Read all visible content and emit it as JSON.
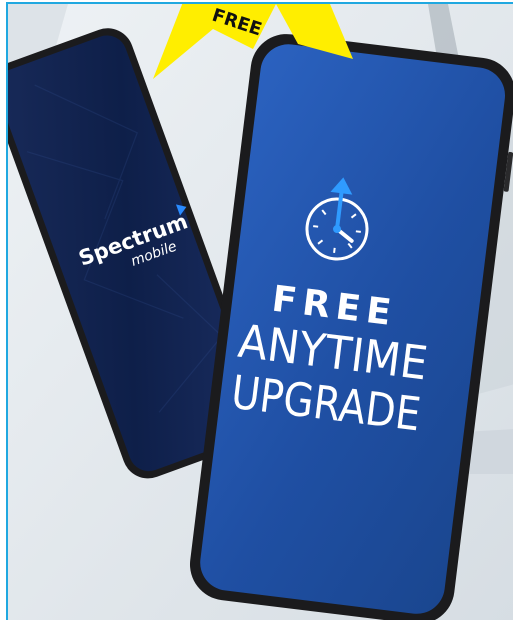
{
  "burst": {
    "label": "FREE"
  },
  "left_phone": {
    "brand": "Spectrum",
    "sub_brand": "mobile"
  },
  "right_phone": {
    "line1": "FREE",
    "line2": "ANYTIME",
    "line3": "UPGRADE"
  },
  "icons": {
    "clock": "clock-with-up-arrow-icon"
  },
  "colors": {
    "screen_blue": "#1f4fa3",
    "burst_yellow": "#ffee00",
    "frame_blue": "#20a8e0",
    "phone_black": "#1b1b1d"
  }
}
